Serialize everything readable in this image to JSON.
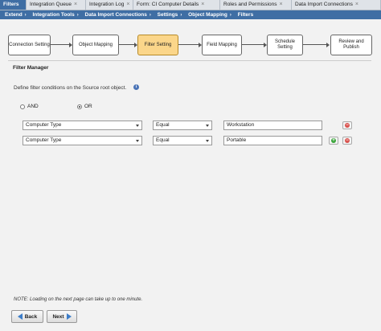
{
  "tabs": [
    {
      "label": "Filters",
      "active": true,
      "closable": false
    },
    {
      "label": "Integration Queue",
      "active": false,
      "closable": true
    },
    {
      "label": "Integration Log",
      "active": false,
      "closable": true
    },
    {
      "label": "Form: CI Computer Details",
      "active": false,
      "closable": true
    },
    {
      "label": "Roles and Permissions",
      "active": false,
      "closable": true
    },
    {
      "label": "Data Import Connections",
      "active": false,
      "closable": true
    }
  ],
  "breadcrumb": [
    "Extend",
    "Integration Tools",
    "Data Import Connections",
    "Settings",
    "Object Mapping",
    "Filters"
  ],
  "wizard_steps": [
    {
      "label": "Connection Setting",
      "active": false
    },
    {
      "label": "Object Mapping",
      "active": false
    },
    {
      "label": "Filter Setting",
      "active": true
    },
    {
      "label": "Field Mapping",
      "active": false
    },
    {
      "label": "Schedule Setting",
      "active": false
    },
    {
      "label": "Review and Publish",
      "active": false
    }
  ],
  "filter_manager": {
    "title": "Filter Manager",
    "instruction": "Define filter conditions on the Source root object.",
    "info_icon": "info-icon",
    "logic_options": [
      {
        "label": "AND",
        "selected": false
      },
      {
        "label": "OR",
        "selected": true
      }
    ],
    "rows": [
      {
        "field": "Computer Type",
        "operator": "Equal",
        "value": "Workstation",
        "has_add": false
      },
      {
        "field": "Computer Type",
        "operator": "Equal",
        "value": "Portable",
        "has_add": true
      }
    ]
  },
  "note": "NOTE: Loading on the next page can take up to one minute.",
  "buttons": {
    "back": "Back",
    "next": "Next"
  },
  "colors": {
    "accent": "#3f6ea4",
    "active_step": "#fbd68a",
    "remove": "#d9534f",
    "add": "#3aa53a"
  }
}
